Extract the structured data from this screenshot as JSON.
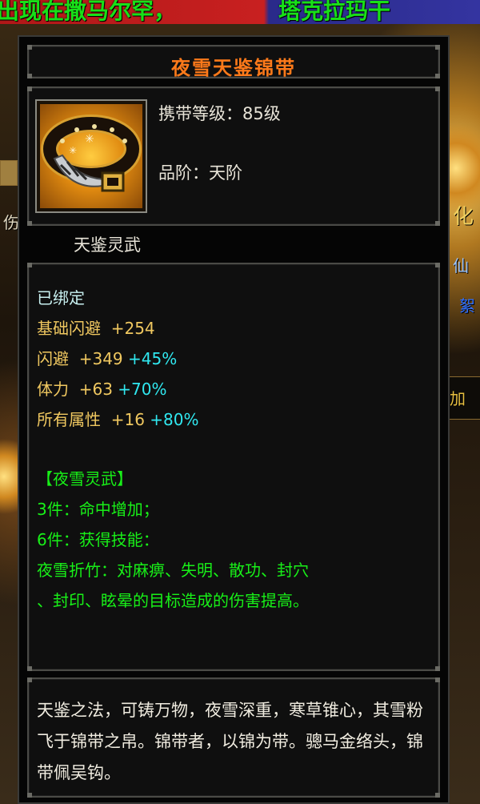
{
  "background": {
    "banner_left": "出现在撒马尔罕，",
    "banner_right": "塔克拉玛干",
    "side_texts": [
      "化",
      "仙",
      "絮",
      "加",
      "伤"
    ]
  },
  "tooltip": {
    "item_name": "夜雪天鉴锦带",
    "level_label": "携带等级：",
    "level_value": "85级",
    "grade_label": "品阶：",
    "grade_value": "天阶",
    "subtitle": "天鉴灵武",
    "bound_status": "已绑定",
    "stats": [
      {
        "name": "基础闪避",
        "flat": "+254",
        "pct": ""
      },
      {
        "name": "闪避",
        "flat": "+349",
        "pct": "+45%"
      },
      {
        "name": "体力",
        "flat": "+63",
        "pct": "+70%"
      },
      {
        "name": "所有属性",
        "flat": "+16",
        "pct": "+80%"
      }
    ],
    "set": {
      "name": "【夜雪灵武】",
      "bonus_3": "3件：命中增加；",
      "bonus_6": "6件：获得技能：",
      "skill_line1": "夜雪折竹：对麻痹、失明、散功、封穴",
      "skill_line2": "、封印、眩晕的目标造成的伤害提高。"
    },
    "description": "天鉴之法，可铸万物，夜雪深重，寒草锥心，其雪粉飞于锦带之帛。锦带者，以锦为带。骢马金络头，锦带佩吴钩。"
  },
  "colors": {
    "title": "#ff7a1a",
    "stat_name": "#f0c860",
    "stat_pct": "#30e8f0",
    "set_text": "#18f018",
    "panel_bg": "#0f0f0f",
    "panel_border": "#4a4a46"
  },
  "icons": {
    "item_icon": "belt-icon"
  }
}
